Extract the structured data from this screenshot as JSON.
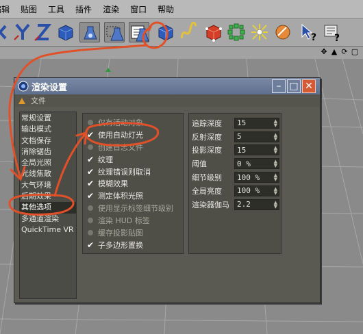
{
  "menubar": {
    "items": [
      "编辑",
      "贴图",
      "工具",
      "插件",
      "渲染",
      "窗口",
      "帮助"
    ]
  },
  "toolbar": {
    "buttons": [
      {
        "icon": "arrow-x-axis-icon"
      },
      {
        "icon": "y-axis-icon"
      },
      {
        "icon": "z-axis-icon"
      },
      {
        "icon": "world-coordinate-cube-icon"
      },
      {
        "icon": "render-active-view-icon"
      },
      {
        "icon": "render-region-icon"
      },
      {
        "icon": "render-settings-icon"
      },
      {
        "icon": "primitive-cube-icon"
      },
      {
        "icon": "spline-icon"
      },
      {
        "icon": "nurbs-cube-icon"
      },
      {
        "icon": "array-icon"
      },
      {
        "icon": "deformer-icon"
      },
      {
        "icon": "scene-object-icon"
      },
      {
        "icon": "help-pointer-icon"
      },
      {
        "icon": "tag-help-icon"
      }
    ]
  },
  "dialog": {
    "title": "渲染设置",
    "menu_file": "文件",
    "categories": [
      "常规设置",
      "输出模式",
      "文档保存",
      "消除锯齿",
      "全局光照",
      "光线焦散",
      "大气环境",
      "后期效果",
      "其他选项",
      "多通道渲染",
      "QuickTime VR"
    ],
    "selected_category": "其他选项",
    "options": [
      {
        "label": "仅有活动对象",
        "checked": false,
        "enabled": false
      },
      {
        "label": "使用自动灯光",
        "checked": true,
        "enabled": true
      },
      {
        "label": "创建日志文件",
        "checked": false,
        "enabled": false
      },
      {
        "label": "纹理",
        "checked": true,
        "enabled": true
      },
      {
        "label": "纹理错误则取消",
        "checked": true,
        "enabled": true
      },
      {
        "label": "模糊效果",
        "checked": true,
        "enabled": true
      },
      {
        "label": "测定体积光照",
        "checked": true,
        "enabled": true
      },
      {
        "label": "使用显示标签细节级别",
        "checked": false,
        "enabled": false
      },
      {
        "label": "渲染 HUD 标签",
        "checked": false,
        "enabled": false
      },
      {
        "label": "缓存投影贴图",
        "checked": false,
        "enabled": false
      },
      {
        "label": "子多边形置换",
        "checked": true,
        "enabled": true
      }
    ],
    "numbers": [
      {
        "label": "追踪深度",
        "value": "15"
      },
      {
        "label": "反射深度",
        "value": "5"
      },
      {
        "label": "投影深度",
        "value": "15"
      },
      {
        "label": "阈值",
        "value": "0 %"
      },
      {
        "label": "细节级别",
        "value": "100 %"
      },
      {
        "label": "全局亮度",
        "value": "100 %"
      },
      {
        "label": "渲染器伽马",
        "value": "2.2"
      }
    ]
  },
  "colors": {
    "annotation": "#e0512a",
    "dialog_bg": "#5a5a52",
    "titlebar": "#6a7b9b",
    "close_button": "#d55a36"
  }
}
